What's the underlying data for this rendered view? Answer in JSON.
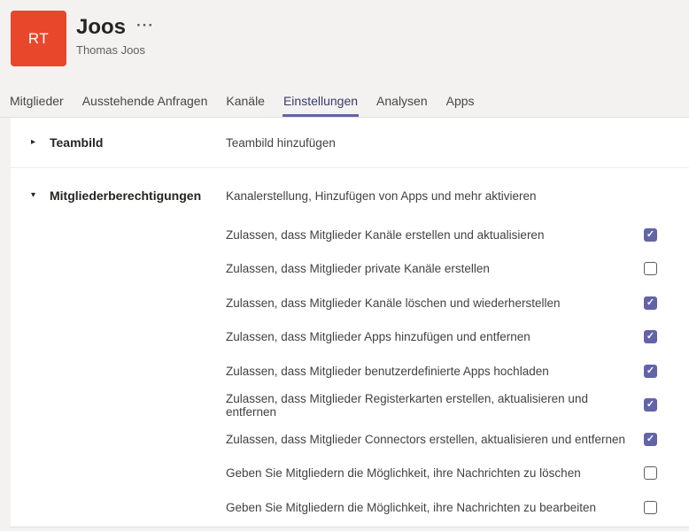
{
  "header": {
    "avatar_initials": "RT",
    "avatar_color": "#e8472b",
    "team_name": "Joos",
    "more_menu": "···",
    "owner_name": "Thomas Joos"
  },
  "accent_color": "#6264a7",
  "icons": {
    "caret_collapsed": "▸",
    "caret_expanded": "▾",
    "check": "✓"
  },
  "tabs": [
    {
      "label": "Mitglieder",
      "active": false
    },
    {
      "label": "Ausstehende Anfragen",
      "active": false
    },
    {
      "label": "Kanäle",
      "active": false
    },
    {
      "label": "Einstellungen",
      "active": true
    },
    {
      "label": "Analysen",
      "active": false
    },
    {
      "label": "Apps",
      "active": false
    }
  ],
  "sections": [
    {
      "label": "Teambild",
      "expanded": false,
      "description": "Teambild hinzufügen"
    },
    {
      "label": "Mitgliederberechtigungen",
      "expanded": true,
      "description": "Kanalerstellung, Hinzufügen von Apps und mehr aktivieren"
    }
  ],
  "permissions": [
    {
      "label": "Zulassen, dass Mitglieder Kanäle erstellen und aktualisieren",
      "checked": true
    },
    {
      "label": "Zulassen, dass Mitglieder private Kanäle erstellen",
      "checked": false
    },
    {
      "label": "Zulassen, dass Mitglieder Kanäle löschen und wiederherstellen",
      "checked": true
    },
    {
      "label": "Zulassen, dass Mitglieder Apps hinzufügen und entfernen",
      "checked": true
    },
    {
      "label": "Zulassen, dass Mitglieder benutzerdefinierte Apps hochladen",
      "checked": true
    },
    {
      "label": "Zulassen, dass Mitglieder Registerkarten erstellen, aktualisieren und entfernen",
      "checked": true
    },
    {
      "label": "Zulassen, dass Mitglieder Connectors erstellen, aktualisieren und entfernen",
      "checked": true
    },
    {
      "label": "Geben Sie Mitgliedern die Möglichkeit, ihre Nachrichten zu löschen",
      "checked": false
    },
    {
      "label": "Geben Sie Mitgliedern die Möglichkeit, ihre Nachrichten zu bearbeiten",
      "checked": false
    }
  ]
}
